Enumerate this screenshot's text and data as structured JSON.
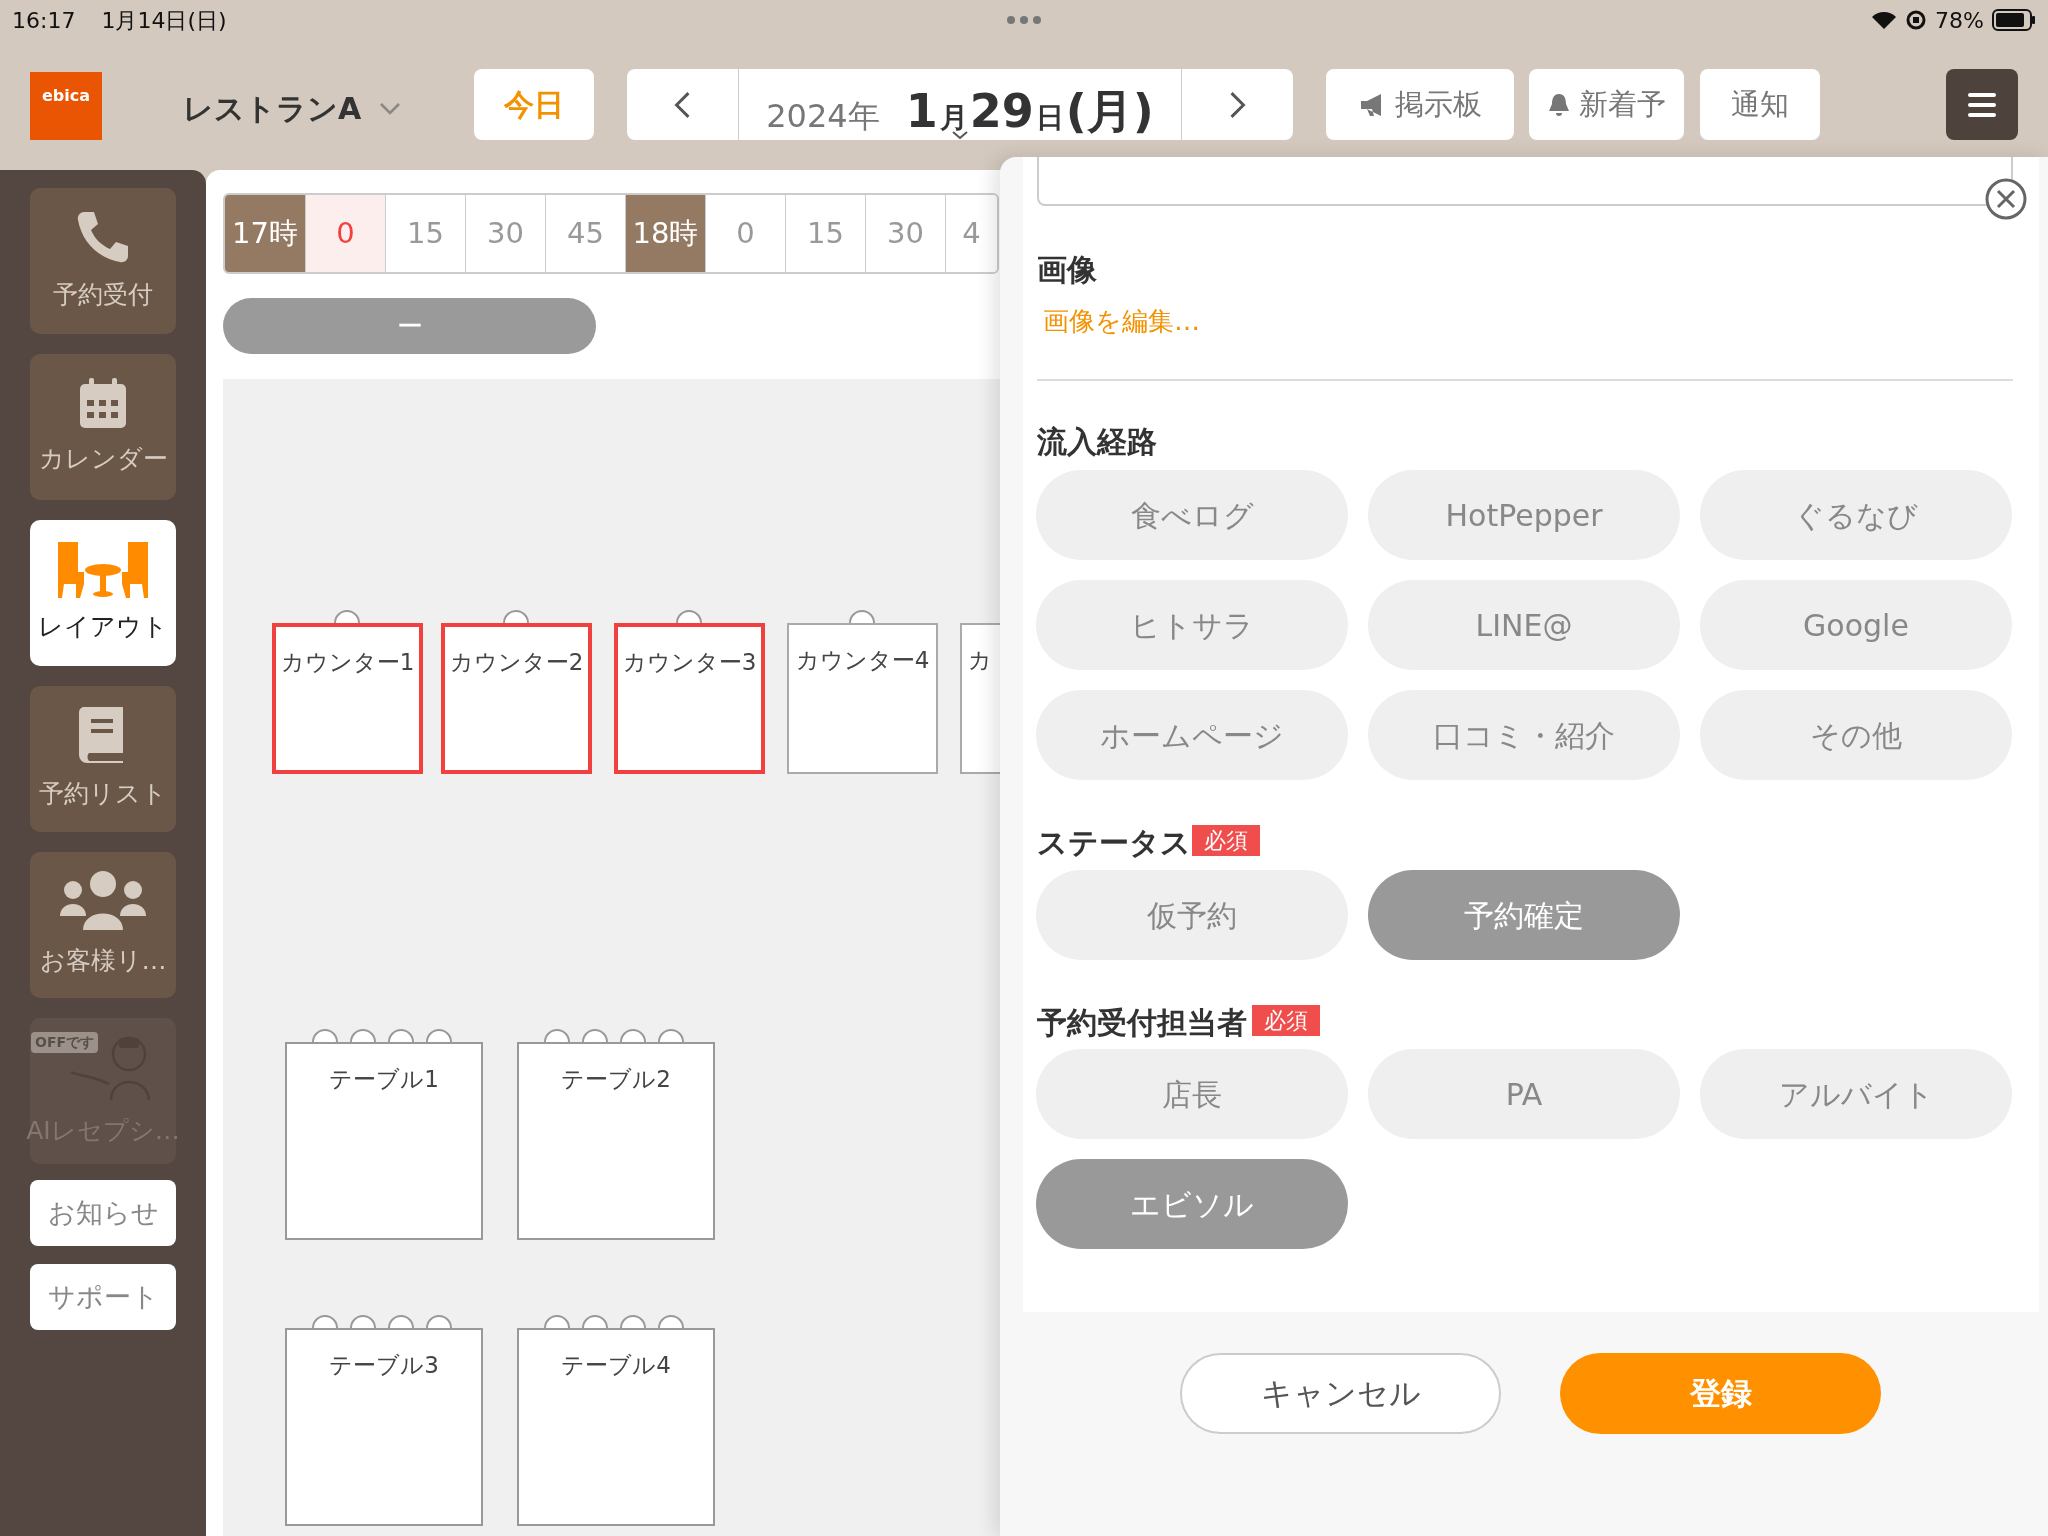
{
  "status_bar": {
    "time": "16:17",
    "date": "1月14日(日)",
    "battery": "78%"
  },
  "header": {
    "logo": "ebica",
    "restaurant": "レストランA",
    "today": "今日",
    "date_parts": [
      {
        "text": "2024年",
        "kind": "small"
      },
      {
        "text": "1",
        "kind": "big"
      },
      {
        "text": "月",
        "kind": "unit"
      },
      {
        "text": "29",
        "kind": "big"
      },
      {
        "text": "日",
        "kind": "unit"
      },
      {
        "text": "(月)",
        "kind": "big"
      }
    ],
    "buttons": [
      {
        "label": "掲示板",
        "kind": "megaphone"
      },
      {
        "label": "新着予",
        "kind": "bell"
      },
      {
        "label": "通知",
        "kind": "plain"
      }
    ]
  },
  "sidebar": {
    "items": [
      {
        "label": "予約受付",
        "selected": false,
        "disabled": false
      },
      {
        "label": "カレンダー",
        "selected": false,
        "disabled": false
      },
      {
        "label": "レイアウト",
        "selected": true,
        "disabled": false
      },
      {
        "label": "予約リスト",
        "selected": false,
        "disabled": false
      },
      {
        "label": "お客様リ…",
        "selected": false,
        "disabled": false
      },
      {
        "label": "AIレセプシ…",
        "selected": false,
        "disabled": true,
        "badge": "OFFです"
      }
    ],
    "links": [
      "お知らせ",
      "サポート"
    ]
  },
  "timeline": {
    "cells": [
      {
        "label": "17時",
        "kind": "hour",
        "selected": false
      },
      {
        "label": "0",
        "kind": "minute",
        "selected": true
      },
      {
        "label": "15",
        "kind": "minute",
        "selected": false
      },
      {
        "label": "30",
        "kind": "minute",
        "selected": false
      },
      {
        "label": "45",
        "kind": "minute",
        "selected": false
      },
      {
        "label": "18時",
        "kind": "hour",
        "selected": false
      },
      {
        "label": "0",
        "kind": "minute",
        "selected": false
      },
      {
        "label": "15",
        "kind": "minute",
        "selected": false
      },
      {
        "label": "30",
        "kind": "minute",
        "selected": false
      },
      {
        "label": "4",
        "kind": "minute",
        "selected": false
      }
    ],
    "bar": "ー"
  },
  "floor": {
    "counters": [
      {
        "label": "カウンター1",
        "highlighted": true
      },
      {
        "label": "カウンター2",
        "highlighted": true
      },
      {
        "label": "カウンター3",
        "highlighted": true
      },
      {
        "label": "カウンター4",
        "highlighted": false
      },
      {
        "label": "カ",
        "highlighted": false
      }
    ],
    "tables": [
      {
        "label": "テーブル1"
      },
      {
        "label": "テーブル2"
      },
      {
        "label": "テーブル3"
      },
      {
        "label": "テーブル4"
      }
    ]
  },
  "panel": {
    "image": {
      "heading": "画像",
      "link": "画像を編集…"
    },
    "sources": {
      "heading": "流入経路",
      "chips": [
        {
          "label": "食べログ",
          "selected": false
        },
        {
          "label": "HotPepper",
          "selected": false
        },
        {
          "label": "ぐるなび",
          "selected": false
        },
        {
          "label": "ヒトサラ",
          "selected": false
        },
        {
          "label": "LINE@",
          "selected": false
        },
        {
          "label": "Google",
          "selected": false
        },
        {
          "label": "ホームページ",
          "selected": false
        },
        {
          "label": "口コミ・紹介",
          "selected": false
        },
        {
          "label": "その他",
          "selected": false
        }
      ]
    },
    "status": {
      "heading": "ステータス",
      "required": "必須",
      "chips": [
        {
          "label": "仮予約",
          "selected": false
        },
        {
          "label": "予約確定",
          "selected": true
        }
      ]
    },
    "staff": {
      "heading": "予約受付担当者",
      "required": "必須",
      "chips": [
        {
          "label": "店長",
          "selected": false
        },
        {
          "label": "PA",
          "selected": false
        },
        {
          "label": "アルバイト",
          "selected": false
        },
        {
          "label": "エビソル",
          "selected": true
        }
      ]
    },
    "cancel": "キャンセル",
    "submit": "登録"
  }
}
